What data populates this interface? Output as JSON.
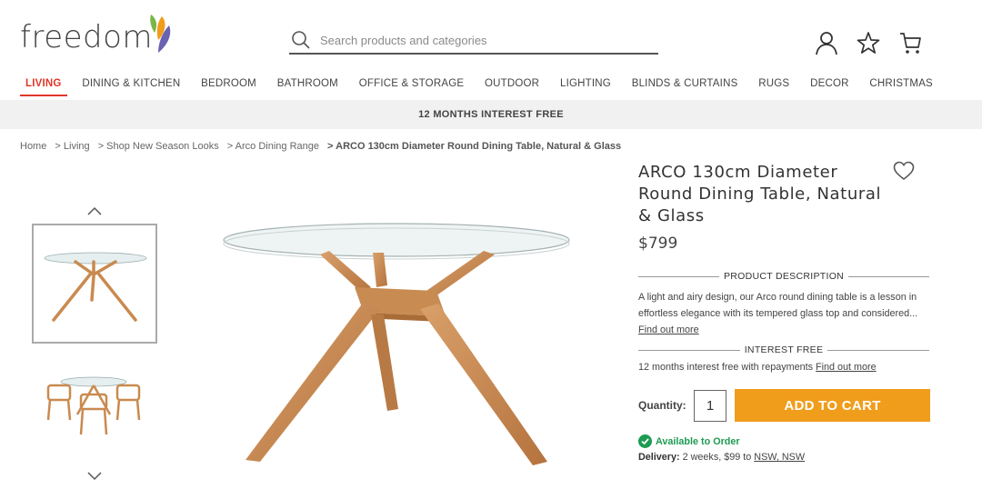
{
  "brand": {
    "name": "freedom"
  },
  "search": {
    "placeholder": "Search products and categories"
  },
  "header_icons": [
    "account-icon",
    "wishlist-star-icon",
    "cart-icon"
  ],
  "nav": {
    "items": [
      {
        "label": "LIVING",
        "active": true
      },
      {
        "label": "DINING & KITCHEN",
        "active": false
      },
      {
        "label": "BEDROOM",
        "active": false
      },
      {
        "label": "BATHROOM",
        "active": false
      },
      {
        "label": "OFFICE & STORAGE",
        "active": false
      },
      {
        "label": "OUTDOOR",
        "active": false
      },
      {
        "label": "LIGHTING",
        "active": false
      },
      {
        "label": "BLINDS & CURTAINS",
        "active": false
      },
      {
        "label": "RUGS",
        "active": false
      },
      {
        "label": "DECOR",
        "active": false
      },
      {
        "label": "CHRISTMAS",
        "active": false
      }
    ]
  },
  "promo": {
    "text": "12 MONTHS INTEREST FREE"
  },
  "breadcrumb": {
    "items": [
      "Home",
      "> Living",
      "> Shop New Season Looks",
      "> Arco Dining Range"
    ],
    "current": "> ARCO 130cm Diameter Round Dining Table, Natural & Glass"
  },
  "product": {
    "title": "ARCO 130cm Diameter Round Dining Table, Natural & Glass",
    "price": "$799",
    "description_heading": "PRODUCT DESCRIPTION",
    "description": "A light and airy design, our Arco round dining table is a lesson in effortless elegance with its tempered glass top and considered...",
    "find_out_more": "Find out more",
    "interest_heading": "INTEREST FREE",
    "interest_text": "12 months interest free with repayments ",
    "interest_link": "Find out more",
    "quantity_label": "Quantity:",
    "quantity_value": "1",
    "add_to_cart": "ADD TO CART",
    "availability": "Available to Order",
    "delivery_label": "Delivery:",
    "delivery_text": " 2 weeks, $99 to ",
    "delivery_link": "NSW, NSW"
  },
  "colors": {
    "accent_red": "#e0382a",
    "cart_orange": "#f09d1c",
    "available_green": "#1d9b52",
    "wood": "#c98a4f"
  }
}
